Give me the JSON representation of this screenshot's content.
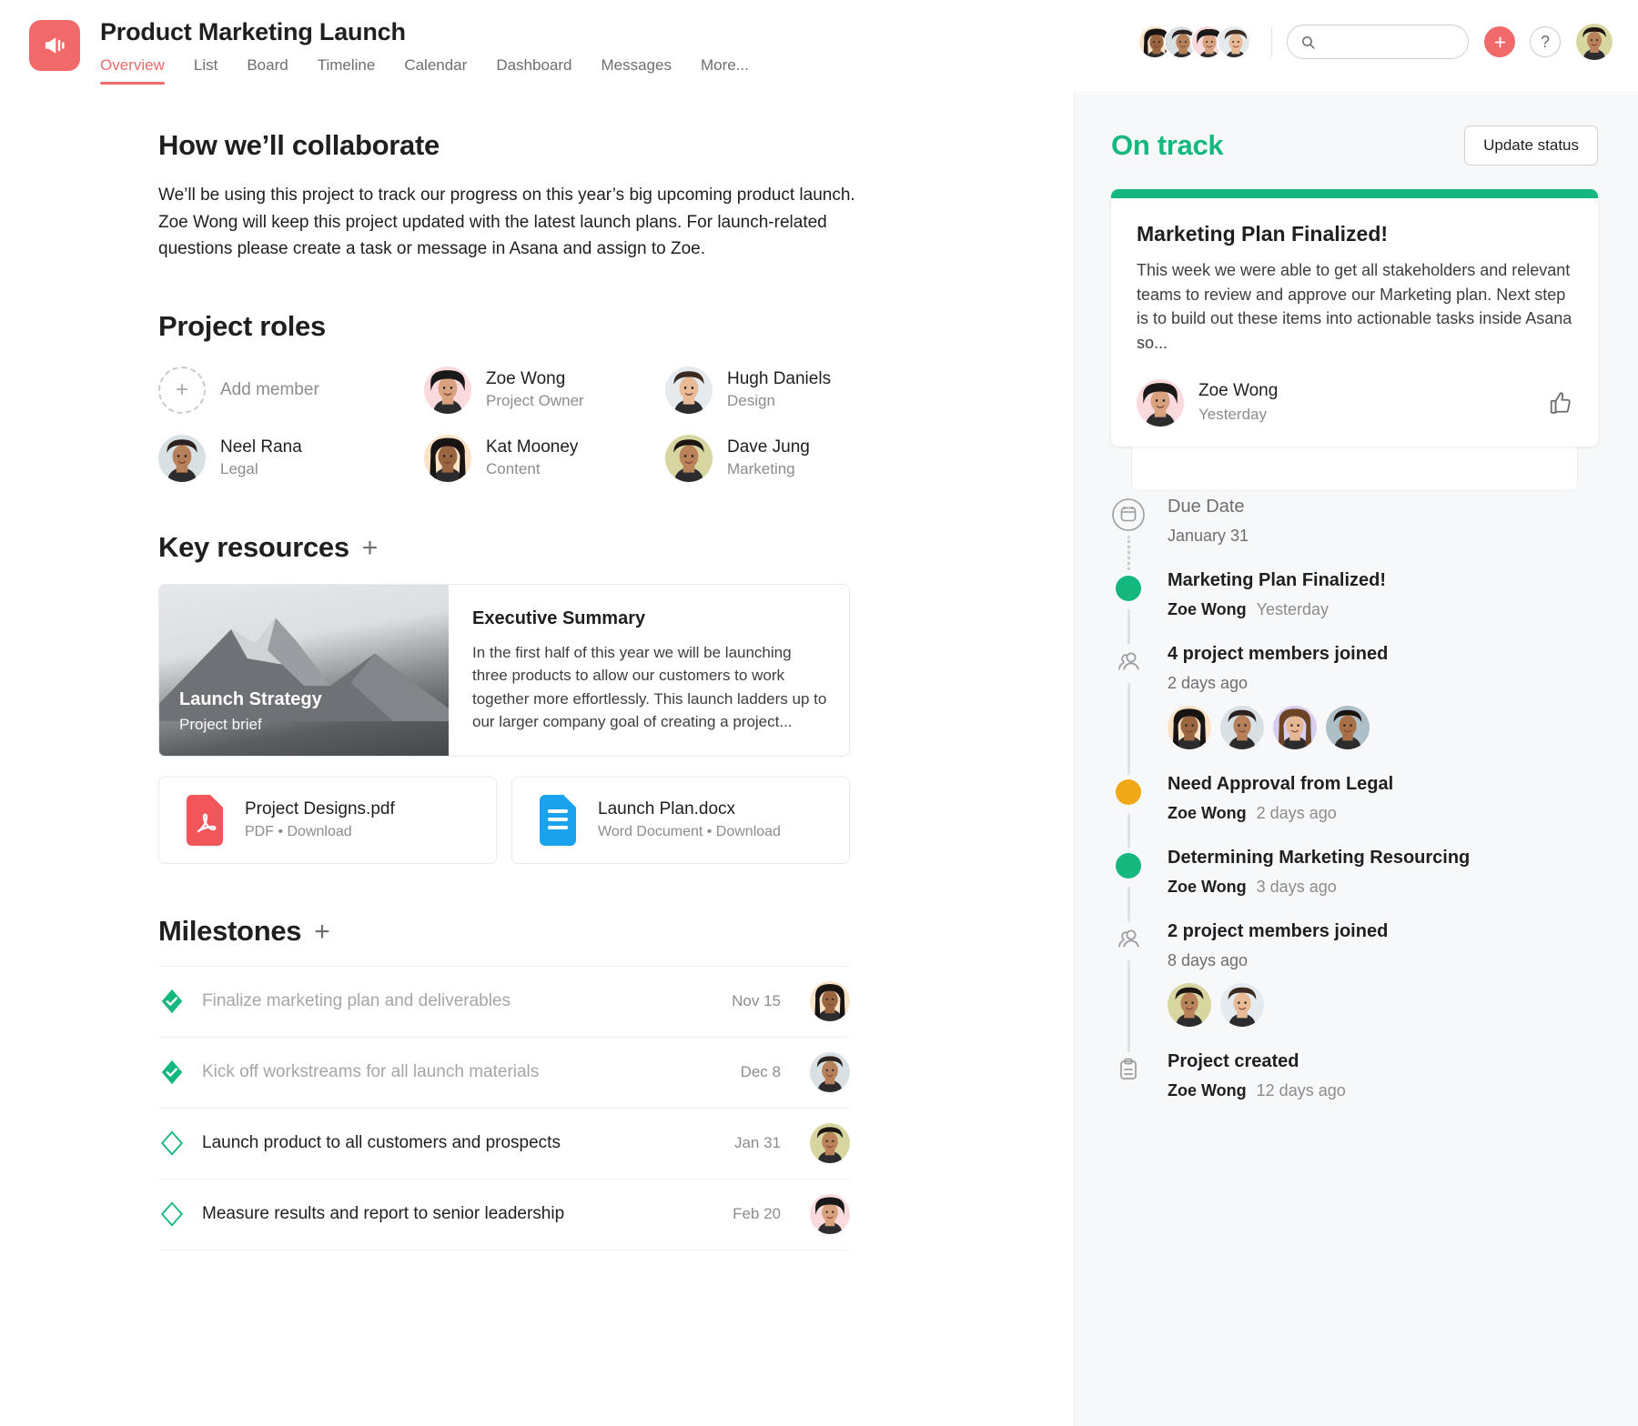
{
  "header": {
    "project_icon": "megaphone-icon",
    "title": "Product Marketing Launch",
    "tabs": [
      {
        "label": "Overview",
        "active": true
      },
      {
        "label": "List",
        "active": false
      },
      {
        "label": "Board",
        "active": false
      },
      {
        "label": "Timeline",
        "active": false
      },
      {
        "label": "Calendar",
        "active": false
      },
      {
        "label": "Dashboard",
        "active": false
      },
      {
        "label": "Messages",
        "active": false
      },
      {
        "label": "More...",
        "active": false
      }
    ],
    "member_avatars": [
      "av-kat",
      "av-neel",
      "av-zoe",
      "av-hugh"
    ],
    "search": {
      "value": "",
      "placeholder": ""
    },
    "add_button_label": "+",
    "help_button_label": "?",
    "me_avatar": "av-dave",
    "accent_color": "#f06a6a"
  },
  "collaborate": {
    "heading": "How we’ll collaborate",
    "body": "We’ll be using this project to track our progress on this year’s big upcoming product launch. Zoe Wong will keep this project updated with the latest launch plans. For launch-related questions please create a task or message in Asana and assign to Zoe."
  },
  "project_roles": {
    "heading": "Project roles",
    "add_member_label": "Add member",
    "members": [
      {
        "name": "Zoe Wong",
        "role": "Project Owner",
        "avatar": "av-zoe"
      },
      {
        "name": "Hugh Daniels",
        "role": "Design",
        "avatar": "av-hugh"
      },
      {
        "name": "Neel Rana",
        "role": "Legal",
        "avatar": "av-neel"
      },
      {
        "name": "Kat Mooney",
        "role": "Content",
        "avatar": "av-kat"
      },
      {
        "name": "Dave Jung",
        "role": "Marketing",
        "avatar": "av-dave"
      }
    ]
  },
  "key_resources": {
    "heading": "Key resources",
    "add_label": "+",
    "featured": {
      "thumb_title": "Launch Strategy",
      "thumb_subtitle": "Project brief",
      "title": "Executive Summary",
      "text": "In the first half of this year we will be launching three products to allow our customers to work together more effortlessly. This launch ladders up to our larger company goal of creating a project..."
    },
    "files": [
      {
        "name": "Project Designs.pdf",
        "meta": "PDF • Download",
        "icon": "pdf-file-icon",
        "color": "#f2555a"
      },
      {
        "name": "Launch Plan.docx",
        "meta": "Word Document • Download",
        "icon": "word-file-icon",
        "color": "#1aa3ec"
      }
    ]
  },
  "milestones": {
    "heading": "Milestones",
    "add_label": "+",
    "rows": [
      {
        "label": "Finalize marketing plan and deliverables",
        "date": "Nov 15",
        "done": true,
        "avatar": "av-kat"
      },
      {
        "label": "Kick off workstreams for all launch materials",
        "date": "Dec 8",
        "done": true,
        "avatar": "av-neel"
      },
      {
        "label": "Launch product to all customers and prospects",
        "date": "Jan 31",
        "done": false,
        "avatar": "av-dave"
      },
      {
        "label": "Measure results and report to senior leadership",
        "date": "Feb 20",
        "done": false,
        "avatar": "av-zoe"
      }
    ]
  },
  "status": {
    "label": "On track",
    "color": "#14b87f",
    "update_button": "Update status",
    "card": {
      "title": "Marketing Plan Finalized!",
      "body": "This week we were able to get all stakeholders and relevant teams to review and approve our Marketing plan. Next step is to build out these items into actionable tasks inside Asana so...",
      "author": "Zoe Wong",
      "time": "Yesterday",
      "avatar": "av-zoe",
      "reaction_icon": "thumbs-up-icon"
    }
  },
  "activity": [
    {
      "kind": "due-date",
      "marker": "calendar-icon",
      "title": "Due Date",
      "value": "January 31",
      "line": "dotted"
    },
    {
      "kind": "status-update",
      "marker": "dot-green",
      "title": "Marketing Plan Finalized!",
      "who": "Zoe Wong",
      "when": "Yesterday",
      "line": "solid"
    },
    {
      "kind": "members-joined",
      "marker": "people-icon",
      "title": "4 project members joined",
      "when": "2 days ago",
      "avatars": [
        "av-kat",
        "av-neel",
        "av-jess",
        "av-raj"
      ],
      "line": "solid"
    },
    {
      "kind": "status-update",
      "marker": "dot-orange",
      "title": "Need Approval from Legal",
      "who": "Zoe Wong",
      "when": "2 days ago",
      "line": "solid"
    },
    {
      "kind": "status-update",
      "marker": "dot-green",
      "title": "Determining Marketing Resourcing",
      "who": "Zoe Wong",
      "when": "3 days ago",
      "line": "solid"
    },
    {
      "kind": "members-joined",
      "marker": "people-icon",
      "title": "2 project members joined",
      "when": "8 days ago",
      "avatars": [
        "av-dave",
        "av-hugh"
      ],
      "line": "solid"
    },
    {
      "kind": "project-created",
      "marker": "clipboard-icon",
      "title": "Project created",
      "who": "Zoe Wong",
      "when": "12 days ago",
      "line": "none"
    }
  ]
}
